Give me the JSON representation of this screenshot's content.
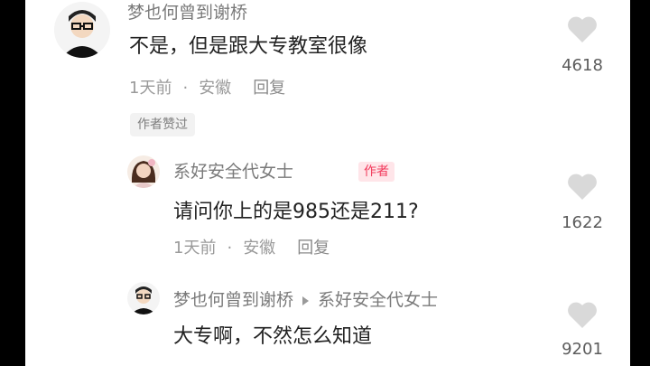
{
  "comments": [
    {
      "username": "梦也何曾到谢桥",
      "text": "不是，但是跟大专教室很像",
      "time": "1天前",
      "location": "安徽",
      "reply_label": "回复",
      "like_count": "4618",
      "badge": "作者赞过"
    },
    {
      "username": "系好安全代女士",
      "author_badge": "作者",
      "text": "请问你上的是985还是211?",
      "time": "1天前",
      "location": "安徽",
      "reply_label": "回复",
      "like_count": "1622"
    },
    {
      "username": "梦也何曾到谢桥",
      "reply_to": "系好安全代女士",
      "text": "大专啊，不然怎么知道",
      "like_count": "9201"
    }
  ],
  "separator": "·",
  "icons": {
    "like": "heart-icon",
    "reply_arrow": "right-triangle-icon"
  },
  "colors": {
    "author_badge_bg": "#ffe5e9",
    "author_badge_text": "#f23a5c",
    "like_icon": "#d9d9d9"
  }
}
